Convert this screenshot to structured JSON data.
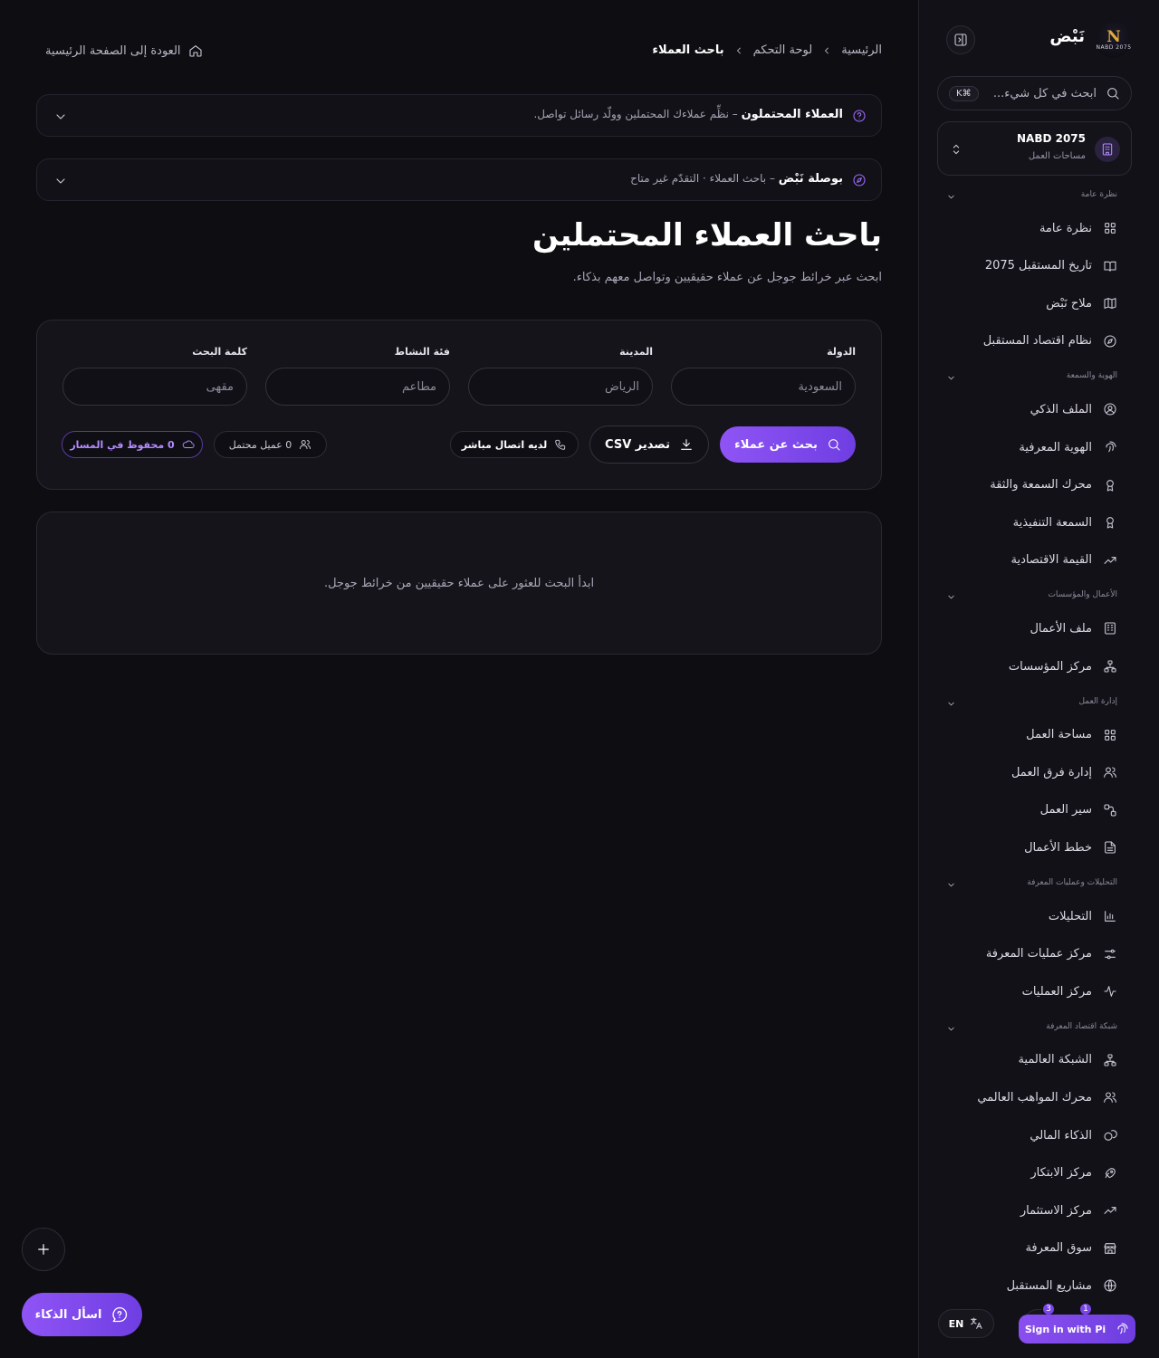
{
  "sidebar": {
    "brand_name": "نَبْض",
    "logo_text": "NABD 2075",
    "search_placeholder": "ابحث في كل شيء...",
    "search_shortcut": "⌘K",
    "workspace": {
      "name": "NABD 2075",
      "subtitle": "مساحات العمل"
    },
    "sections": [
      {
        "title": "نظرة عامة",
        "items": [
          {
            "label": "نظرة عامة",
            "icon": "grid-icon"
          },
          {
            "label": "تاريخ المستقبل 2075",
            "icon": "book-icon"
          },
          {
            "label": "ملاح نَبْض",
            "icon": "map-icon"
          },
          {
            "label": "نظام اقتصاد المستقبل",
            "icon": "compass-icon"
          }
        ]
      },
      {
        "title": "الهوية والسمعة",
        "items": [
          {
            "label": "الملف الذكي",
            "icon": "user-circle-icon"
          },
          {
            "label": "الهوية المعرفية",
            "icon": "fingerprint-icon"
          },
          {
            "label": "محرك السمعة والثقة",
            "icon": "award-icon"
          },
          {
            "label": "السمعة التنفيذية",
            "icon": "award-icon"
          },
          {
            "label": "القيمة الاقتصادية",
            "icon": "trending-up-icon"
          }
        ]
      },
      {
        "title": "الأعمال والمؤسسات",
        "items": [
          {
            "label": "ملف الأعمال",
            "icon": "building-icon"
          },
          {
            "label": "مركز المؤسسات",
            "icon": "network-icon"
          }
        ]
      },
      {
        "title": "إدارة العمل",
        "items": [
          {
            "label": "مساحة العمل",
            "icon": "grid-icon"
          },
          {
            "label": "إدارة فرق العمل",
            "icon": "users-icon"
          },
          {
            "label": "سير العمل",
            "icon": "workflow-icon"
          },
          {
            "label": "خطط الأعمال",
            "icon": "file-text-icon"
          }
        ]
      },
      {
        "title": "التحليلات وعمليات المعرفة",
        "items": [
          {
            "label": "التحليلات",
            "icon": "bar-chart-icon"
          },
          {
            "label": "مركز عمليات المعرفة",
            "icon": "sliders-icon"
          },
          {
            "label": "مركز العمليات",
            "icon": "activity-icon"
          }
        ]
      },
      {
        "title": "شبكة اقتصاد المعرفة",
        "items": [
          {
            "label": "الشبكة العالمية",
            "icon": "network-icon"
          },
          {
            "label": "محرك المواهب العالمي",
            "icon": "users-icon"
          },
          {
            "label": "الذكاء المالي",
            "icon": "coins-icon"
          },
          {
            "label": "مركز الابتكار",
            "icon": "rocket-icon"
          },
          {
            "label": "مركز الاستثمار",
            "icon": "trending-up-icon"
          },
          {
            "label": "سوق المعرفة",
            "icon": "store-icon"
          },
          {
            "label": "مشاريع المستقبل",
            "icon": "globe-icon"
          }
        ]
      }
    ],
    "bottom": {
      "lang_label": "EN",
      "pi_button": "Sign in with Pi",
      "badge_a": "3",
      "badge_b": "1"
    }
  },
  "header": {
    "breadcrumbs": [
      "الرئيسية",
      "لوحة التحكم",
      "باحث العملاء"
    ],
    "back_link": "العودة إلى الصفحة الرئيسية"
  },
  "accordions": [
    {
      "title": "العملاء المحتملون",
      "desc": "– نظِّم عملاءك المحتملين وولّد رسائل تواصل."
    },
    {
      "title": "بوصلة نَبْض",
      "desc": "– باحث العملاء · التقدّم غير متاح"
    }
  ],
  "page": {
    "title": "باحث العملاء المحتملين",
    "subtitle": "ابحث عبر خرائط جوجل عن عملاء حقيقيين وتواصل معهم بذكاء."
  },
  "form": {
    "fields": [
      {
        "label": "الدولة",
        "placeholder": "السعودية"
      },
      {
        "label": "المدينة",
        "placeholder": "الرياض"
      },
      {
        "label": "فئة النشاط",
        "placeholder": "مطاعم"
      },
      {
        "label": "كلمة البحث",
        "placeholder": "مقهى"
      }
    ],
    "search_button": "بحث عن عملاء",
    "csv_button": "تصدير CSV",
    "phone_pill": "لديه اتصال مباشر",
    "count_pill": "0 عميل محتمل",
    "saved_pill": "0 محفوظ في المسار"
  },
  "empty_state": "ابدأ البحث للعثور على عملاء حقيقيين من خرائط جوجل.",
  "floating": {
    "ask_ai": "اسأل الذكاء"
  }
}
